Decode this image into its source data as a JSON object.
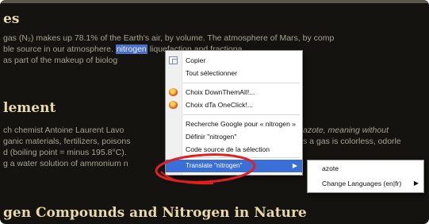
{
  "article": {
    "heading_top": "es",
    "para1": [
      {
        "pre": "gas (N₂) makes up 78.1% of the Earth's air, by volume. The atmosphere of Mars, by comp",
        "hl": "",
        "post": ""
      },
      {
        "pre": "ble source in our atmosphere. ",
        "hl": "nitrogen",
        "post": "          liquefaction and fractiona"
      },
      {
        "pre": "as part of the makeup of biolog",
        "hl": "",
        "post": ""
      }
    ],
    "heading_mid": "lement",
    "para2": [
      {
        "pre": "ch chemist Antoine Laurent Lavo",
        "post": "azote, meaning ",
        "em": "without"
      },
      {
        "pre": "ganic materials, fertilizers, poisons",
        "post": "s a gas is colorless, odorle"
      },
      {
        "pre": "d (boiling point = minus 195.8°C).",
        "post": ""
      },
      {
        "pre": "g a water solution of ammonium n",
        "post": ""
      }
    ],
    "heading_bottom": "gen Compounds and Nitrogen in Nature"
  },
  "context_menu": {
    "items": [
      {
        "label": "Copier",
        "icon": "copy-icon"
      },
      {
        "label": "Tout sélectionner",
        "icon": ""
      },
      {
        "label": "Choix DownThemAll!...",
        "icon": "downthemall-icon"
      },
      {
        "label": "Choix dTa OneClick!...",
        "icon": "downthemall-icon"
      },
      {
        "label": "Recherche Google pour « nitrogen »",
        "icon": ""
      },
      {
        "label": "Définir \"nitrogen\"",
        "icon": ""
      },
      {
        "label": "Code source de la sélection",
        "icon": ""
      },
      {
        "label": "Translate \"nitrogen\"",
        "icon": "",
        "active": true
      }
    ]
  },
  "submenu": {
    "items": [
      {
        "label": "azote"
      },
      {
        "label": "Change Languages (en|fr)"
      }
    ]
  },
  "colors": {
    "page_bg": "#14130f",
    "heading": "#e8d9a6",
    "selection": "#3a6fd8",
    "annotation": "#e02020"
  }
}
